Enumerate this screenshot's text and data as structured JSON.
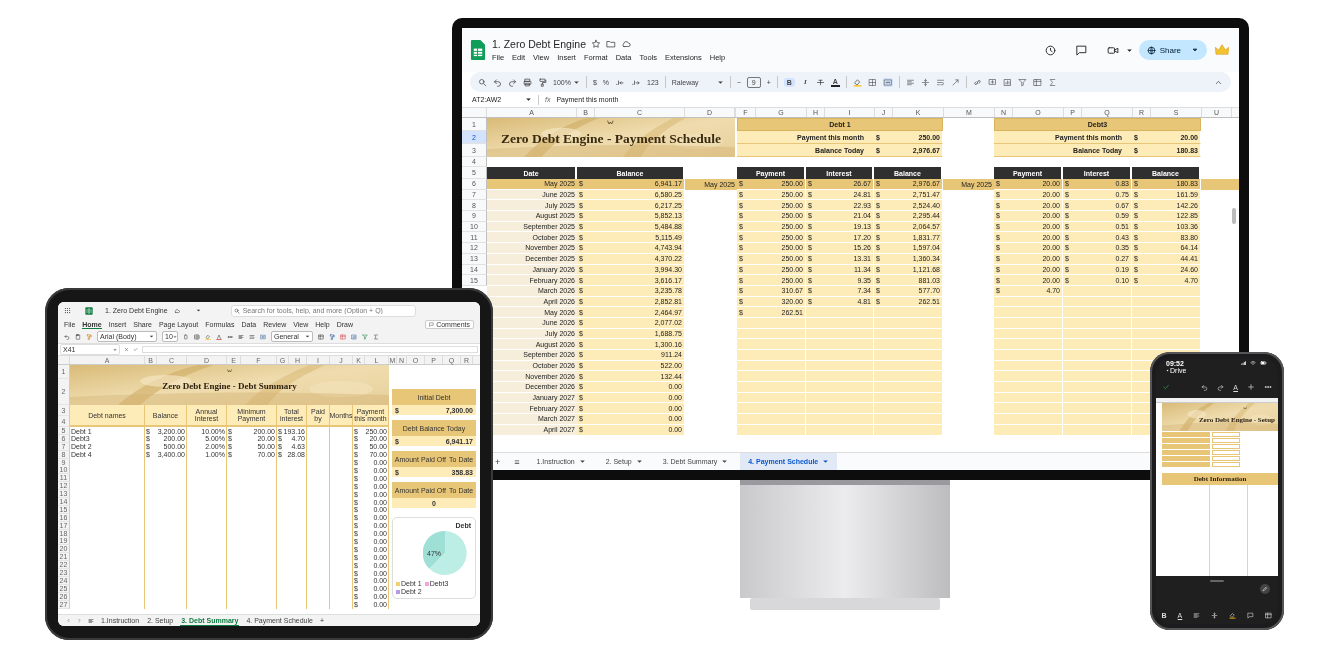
{
  "sheets_window": {
    "title": "1. Zero Debt Engine",
    "menus": [
      "File",
      "Edit",
      "View",
      "Insert",
      "Format",
      "Data",
      "Tools",
      "Extensions",
      "Help"
    ],
    "share": "Share",
    "toolbar": {
      "zoom": "100%",
      "currency": "$",
      "percent": "%",
      "number_format": "123",
      "font": "Raleway",
      "minus": "−",
      "size": "9",
      "plus": "+",
      "format_buttons": [
        {
          "label": "B",
          "on": true
        },
        {
          "label": "I",
          "on": false
        },
        {
          "label": "A",
          "on": false
        }
      ]
    },
    "name_box": "AT2:AW2",
    "fx": "fx",
    "formula": "Payment this month",
    "columns": [
      "A",
      "B",
      "C",
      "D",
      "F",
      "G",
      "H",
      "I",
      "J",
      "K",
      "M",
      "N",
      "O",
      "P",
      "Q",
      "R",
      "S",
      "U"
    ],
    "top_rows": [
      {
        "num": "1",
        "selected": false
      },
      {
        "num": "2",
        "selected": true
      },
      {
        "num": "3",
        "selected": false
      },
      {
        "num": "4",
        "selected": false
      },
      {
        "num": "5",
        "selected": false
      }
    ],
    "sheet_title": "Zero Debt Engine - Payment Schedule",
    "debts": [
      {
        "name": "Debt 1",
        "payment_label": "Payment this month",
        "payment": [
          "$",
          "250.00"
        ],
        "balance_label": "Balance Today",
        "balance": [
          "$",
          "2,976.67"
        ]
      },
      {
        "name": "Debt3",
        "payment_label": "Payment this month",
        "payment": [
          "$",
          "20.00"
        ],
        "balance_label": "Balance Today",
        "balance": [
          "$",
          "180.83"
        ]
      }
    ],
    "table_headers": [
      "Date",
      "Balance",
      "Payment",
      "Interest",
      "Balance",
      "Payment",
      "Interest",
      "Balance"
    ],
    "rows": [
      {
        "num": "6",
        "highlight": true,
        "date": "May 2025",
        "balance": [
          "$",
          "6,941.17"
        ],
        "month": "May 2025",
        "d1": [
          [
            "$",
            "250.00"
          ],
          [
            "$",
            "26.67"
          ],
          [
            "$",
            "2,976.67"
          ]
        ],
        "month2": "May 2025",
        "d3": [
          [
            "$",
            "20.00"
          ],
          [
            "$",
            "0.83"
          ],
          [
            "$",
            "180.83"
          ]
        ]
      },
      {
        "num": "7",
        "highlight": false,
        "date": "June 2025",
        "balance": [
          "$",
          "6,580.25"
        ],
        "d1": [
          [
            "$",
            "250.00"
          ],
          [
            "$",
            "24.81"
          ],
          [
            "$",
            "2,751.47"
          ]
        ],
        "d3": [
          [
            "$",
            "20.00"
          ],
          [
            "$",
            "0.75"
          ],
          [
            "$",
            "161.59"
          ]
        ]
      },
      {
        "num": "8",
        "highlight": false,
        "date": "July 2025",
        "balance": [
          "$",
          "6,217.25"
        ],
        "d1": [
          [
            "$",
            "250.00"
          ],
          [
            "$",
            "22.93"
          ],
          [
            "$",
            "2,524.40"
          ]
        ],
        "d3": [
          [
            "$",
            "20.00"
          ],
          [
            "$",
            "0.67"
          ],
          [
            "$",
            "142.26"
          ]
        ]
      },
      {
        "num": "9",
        "highlight": false,
        "date": "August 2025",
        "balance": [
          "$",
          "5,852.13"
        ],
        "d1": [
          [
            "$",
            "250.00"
          ],
          [
            "$",
            "21.04"
          ],
          [
            "$",
            "2,295.44"
          ]
        ],
        "d3": [
          [
            "$",
            "20.00"
          ],
          [
            "$",
            "0.59"
          ],
          [
            "$",
            "122.85"
          ]
        ]
      },
      {
        "num": "10",
        "highlight": false,
        "date": "September 2025",
        "balance": [
          "$",
          "5,484.88"
        ],
        "d1": [
          [
            "$",
            "250.00"
          ],
          [
            "$",
            "19.13"
          ],
          [
            "$",
            "2,064.57"
          ]
        ],
        "d3": [
          [
            "$",
            "20.00"
          ],
          [
            "$",
            "0.51"
          ],
          [
            "$",
            "103.36"
          ]
        ]
      },
      {
        "num": "11",
        "highlight": false,
        "date": "October 2025",
        "balance": [
          "$",
          "5,115.49"
        ],
        "d1": [
          [
            "$",
            "250.00"
          ],
          [
            "$",
            "17.20"
          ],
          [
            "$",
            "1,831.77"
          ]
        ],
        "d3": [
          [
            "$",
            "20.00"
          ],
          [
            "$",
            "0.43"
          ],
          [
            "$",
            "83.80"
          ]
        ]
      },
      {
        "num": "12",
        "highlight": false,
        "date": "November 2025",
        "balance": [
          "$",
          "4,743.94"
        ],
        "d1": [
          [
            "$",
            "250.00"
          ],
          [
            "$",
            "15.26"
          ],
          [
            "$",
            "1,597.04"
          ]
        ],
        "d3": [
          [
            "$",
            "20.00"
          ],
          [
            "$",
            "0.35"
          ],
          [
            "$",
            "64.14"
          ]
        ]
      },
      {
        "num": "13",
        "highlight": false,
        "date": "December 2025",
        "balance": [
          "$",
          "4,370.22"
        ],
        "d1": [
          [
            "$",
            "250.00"
          ],
          [
            "$",
            "13.31"
          ],
          [
            "$",
            "1,360.34"
          ]
        ],
        "d3": [
          [
            "$",
            "20.00"
          ],
          [
            "$",
            "0.27"
          ],
          [
            "$",
            "44.41"
          ]
        ]
      },
      {
        "num": "14",
        "highlight": false,
        "date": "January 2026",
        "balance": [
          "$",
          "3,994.30"
        ],
        "d1": [
          [
            "$",
            "250.00"
          ],
          [
            "$",
            "11.34"
          ],
          [
            "$",
            "1,121.68"
          ]
        ],
        "d3": [
          [
            "$",
            "20.00"
          ],
          [
            "$",
            "0.19"
          ],
          [
            "$",
            "24.60"
          ]
        ]
      },
      {
        "num": "15",
        "highlight": false,
        "date": "February 2026",
        "balance": [
          "$",
          "3,616.17"
        ],
        "d1": [
          [
            "$",
            "250.00"
          ],
          [
            "$",
            "9.35"
          ],
          [
            "$",
            "881.03"
          ]
        ],
        "d3": [
          [
            "$",
            "20.00"
          ],
          [
            "$",
            "0.10"
          ],
          [
            "$",
            "4.70"
          ]
        ]
      },
      {
        "highlight": false,
        "date": "March 2026",
        "balance": [
          "$",
          "3,235.78"
        ],
        "d1": [
          [
            "$",
            "310.67"
          ],
          [
            "$",
            "7.34"
          ],
          [
            "$",
            "577.70"
          ]
        ],
        "d3": [
          [
            "$",
            "4.70"
          ]
        ]
      },
      {
        "highlight": false,
        "date": "April 2026",
        "balance": [
          "$",
          "2,852.81"
        ],
        "d1": [
          [
            "$",
            "320.00"
          ],
          [
            "$",
            "4.81"
          ],
          [
            "$",
            "262.51"
          ]
        ],
        "d3": []
      },
      {
        "highlight": false,
        "date": "May 2026",
        "balance": [
          "$",
          "2,464.97"
        ],
        "d1": [
          [
            "$",
            "262.51"
          ]
        ],
        "d3": []
      },
      {
        "highlight": false,
        "date": "June 2026",
        "balance": [
          "$",
          "2,077.02"
        ],
        "d1": [],
        "d3": []
      },
      {
        "highlight": false,
        "date": "July 2026",
        "balance": [
          "$",
          "1,688.75"
        ],
        "d1": [],
        "d3": []
      },
      {
        "highlight": false,
        "date": "August 2026",
        "balance": [
          "$",
          "1,300.16"
        ],
        "d1": [],
        "d3": []
      },
      {
        "highlight": false,
        "date": "September 2026",
        "balance": [
          "$",
          "911.24"
        ],
        "d1": [],
        "d3": []
      },
      {
        "highlight": false,
        "date": "October 2026",
        "balance": [
          "$",
          "522.00"
        ],
        "d1": [],
        "d3": []
      },
      {
        "highlight": false,
        "date": "November 2026",
        "balance": [
          "$",
          "132.44"
        ],
        "d1": [],
        "d3": []
      },
      {
        "highlight": false,
        "date": "December 2026",
        "balance": [
          "$",
          "0.00"
        ],
        "d1": [],
        "d3": []
      },
      {
        "highlight": false,
        "date": "January 2027",
        "balance": [
          "$",
          "0.00"
        ],
        "d1": [],
        "d3": []
      },
      {
        "highlight": false,
        "date": "February 2027",
        "balance": [
          "$",
          "0.00"
        ],
        "d1": [],
        "d3": []
      },
      {
        "highlight": false,
        "date": "March 2027",
        "balance": [
          "$",
          "0.00"
        ],
        "d1": [],
        "d3": []
      },
      {
        "highlight": false,
        "date": "April 2027",
        "balance": [
          "$",
          "0.00"
        ],
        "d1": [],
        "d3": []
      }
    ],
    "add_sheet": "+",
    "sheet_list": "≡",
    "tabs": [
      {
        "label": "1.Instruction",
        "selected": false
      },
      {
        "label": "2. Setup",
        "selected": false
      },
      {
        "label": "3. Debt Summary",
        "selected": false
      },
      {
        "label": "4. Payment Schedule",
        "selected": true
      }
    ]
  },
  "excel_tablet": {
    "title": "1. Zero Debt Engine",
    "search": {
      "placeholder": "Search for tools, help, and more (Option + Q)"
    },
    "menus": [
      {
        "label": "File",
        "selected": false
      },
      {
        "label": "Home",
        "selected": true
      },
      {
        "label": "Insert",
        "selected": false
      },
      {
        "label": "Share",
        "selected": false
      },
      {
        "label": "Page Layout",
        "selected": false
      },
      {
        "label": "Formulas",
        "selected": false
      },
      {
        "label": "Data",
        "selected": false
      },
      {
        "label": "Review",
        "selected": false
      },
      {
        "label": "View",
        "selected": false
      },
      {
        "label": "Help",
        "selected": false
      },
      {
        "label": "Draw",
        "selected": false
      }
    ],
    "comments": "Comments",
    "font": "Arial (Body)",
    "size": "10",
    "number_format": "General",
    "name_box": "X41",
    "columns": [
      "A",
      "B",
      "C",
      "D",
      "E",
      "F",
      "G",
      "H",
      "I",
      "J",
      "K",
      "L",
      "M",
      "N",
      "O",
      "P",
      "Q",
      "R"
    ],
    "sheet_title": "Zero Debt Engine - Debt Summary",
    "headers": [
      "Debt names",
      "Balance",
      "Annual Interest",
      "Minimum Payment",
      "Total interest",
      "Paid by",
      "Months",
      "Payment this month"
    ],
    "debts": [
      {
        "num": "5",
        "name": "Debt 1",
        "balance": [
          "$",
          "3,200.00"
        ],
        "rate": "10.00%",
        "min": [
          "$",
          "200.00"
        ],
        "interest": [
          "$",
          "193.16"
        ],
        "pay": [
          "$",
          "250.00"
        ]
      },
      {
        "num": "6",
        "name": "Debt3",
        "balance": [
          "$",
          "200.00"
        ],
        "rate": "5.00%",
        "min": [
          "$",
          "20.00"
        ],
        "interest": [
          "$",
          "4.70"
        ],
        "pay": [
          "$",
          "20.00"
        ]
      },
      {
        "num": "7",
        "name": "Debt 2",
        "balance": [
          "$",
          "500.00"
        ],
        "rate": "2.00%",
        "min": [
          "$",
          "50.00"
        ],
        "interest": [
          "$",
          "4.63"
        ],
        "pay": [
          "$",
          "50.00"
        ]
      },
      {
        "num": "8",
        "name": "Debt 4",
        "balance": [
          "$",
          "3,400.00"
        ],
        "rate": "1.00%",
        "min": [
          "$",
          "70.00"
        ],
        "interest": [
          "$",
          "28.08"
        ],
        "pay": [
          "$",
          "70.00"
        ]
      }
    ],
    "empty_rows": [
      {
        "num": "9",
        "pay": [
          "$",
          "0.00"
        ]
      },
      {
        "num": "10",
        "pay": [
          "$",
          "0.00"
        ]
      },
      {
        "num": "11",
        "pay": [
          "$",
          "0.00"
        ]
      },
      {
        "num": "12",
        "pay": [
          "$",
          "0.00"
        ]
      },
      {
        "num": "13",
        "pay": [
          "$",
          "0.00"
        ]
      },
      {
        "num": "14",
        "pay": [
          "$",
          "0.00"
        ]
      },
      {
        "num": "15",
        "pay": [
          "$",
          "0.00"
        ]
      },
      {
        "num": "16",
        "pay": [
          "$",
          "0.00"
        ]
      },
      {
        "num": "17",
        "pay": [
          "$",
          "0.00"
        ]
      },
      {
        "num": "18",
        "pay": [
          "$",
          "0.00"
        ]
      },
      {
        "num": "19",
        "pay": [
          "$",
          "0.00"
        ]
      },
      {
        "num": "20",
        "pay": [
          "$",
          "0.00"
        ]
      },
      {
        "num": "21",
        "pay": [
          "$",
          "0.00"
        ]
      },
      {
        "num": "22",
        "pay": [
          "$",
          "0.00"
        ]
      },
      {
        "num": "23",
        "pay": [
          "$",
          "0.00"
        ]
      },
      {
        "num": "24",
        "pay": [
          "$",
          "0.00"
        ]
      },
      {
        "num": "25",
        "pay": [
          "$",
          "0.00"
        ]
      },
      {
        "num": "26",
        "pay": [
          "$",
          "0.00"
        ]
      },
      {
        "num": "27",
        "pay": [
          "$",
          "0.00"
        ]
      }
    ],
    "band_rows": [
      "1",
      "2",
      "3",
      "4"
    ],
    "cards": [
      {
        "labels": [
          "Initial Debt"
        ],
        "value": [
          "$",
          "7,300.00"
        ]
      },
      {
        "labels": [
          "Debt Balance Today"
        ],
        "value": [
          "$",
          "6,941.17"
        ]
      },
      {
        "labels": [
          "Amount Paid Off",
          "To Date"
        ],
        "value": [
          "$",
          "358.83"
        ]
      },
      {
        "labels": [
          "Amount Paid Off",
          "To Date"
        ],
        "value": [
          "0"
        ]
      }
    ],
    "chart": {
      "title": "Debt",
      "slice_label": "47%",
      "legend": [
        {
          "label": "Debt 1",
          "color": "#f2d16b"
        },
        {
          "label": "Debt3",
          "color": "#f0a6d8"
        },
        {
          "label": "Debt 2",
          "color": "#b59be6"
        }
      ]
    },
    "tabs": [
      {
        "label": "1.Instruction",
        "selected": false
      },
      {
        "label": "2. Setup",
        "selected": false
      },
      {
        "label": "3. Debt Summary",
        "selected": true
      },
      {
        "label": "4. Payment Schedule",
        "selected": false
      }
    ],
    "add_sheet": "+"
  },
  "phone": {
    "time": "09:52",
    "back": "Drive",
    "format_letter": "A",
    "sheet_title": "Zero Debt Engine - Setup",
    "section": "Debt Information",
    "bottom_letters": [
      "B",
      "A"
    ]
  }
}
